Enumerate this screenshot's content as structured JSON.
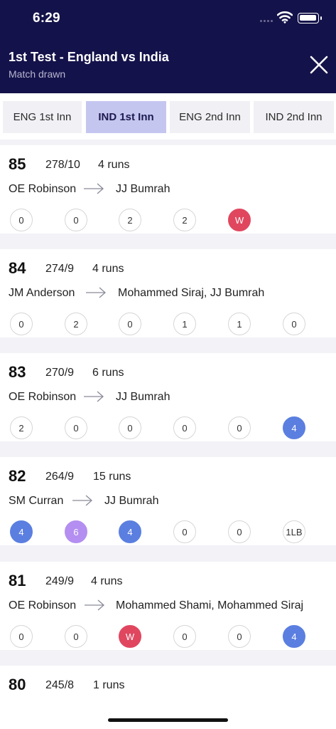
{
  "status": {
    "time": "6:29"
  },
  "header": {
    "title": "1st Test - England vs India",
    "subtitle": "Match drawn"
  },
  "tabs": [
    {
      "label": "ENG 1st Inn",
      "active": false
    },
    {
      "label": "IND 1st Inn",
      "active": true
    },
    {
      "label": "ENG 2nd Inn",
      "active": false
    },
    {
      "label": "IND 2nd Inn",
      "active": false
    }
  ],
  "overs": [
    {
      "over": "85",
      "score": "278/10",
      "runs": "4 runs",
      "bowler": "OE Robinson",
      "batters": "JJ Bumrah",
      "balls": [
        {
          "v": "0",
          "t": "dot"
        },
        {
          "v": "0",
          "t": "dot"
        },
        {
          "v": "2",
          "t": "run"
        },
        {
          "v": "2",
          "t": "run"
        },
        {
          "v": "W",
          "t": "wicket"
        }
      ]
    },
    {
      "over": "84",
      "score": "274/9",
      "runs": "4 runs",
      "bowler": "JM Anderson",
      "batters": "Mohammed Siraj, JJ Bumrah",
      "balls": [
        {
          "v": "0",
          "t": "dot"
        },
        {
          "v": "2",
          "t": "run"
        },
        {
          "v": "0",
          "t": "dot"
        },
        {
          "v": "1",
          "t": "run"
        },
        {
          "v": "1",
          "t": "run"
        },
        {
          "v": "0",
          "t": "dot"
        }
      ]
    },
    {
      "over": "83",
      "score": "270/9",
      "runs": "6 runs",
      "bowler": "OE Robinson",
      "batters": "JJ Bumrah",
      "balls": [
        {
          "v": "2",
          "t": "run"
        },
        {
          "v": "0",
          "t": "dot"
        },
        {
          "v": "0",
          "t": "dot"
        },
        {
          "v": "0",
          "t": "dot"
        },
        {
          "v": "0",
          "t": "dot"
        },
        {
          "v": "4",
          "t": "four"
        }
      ]
    },
    {
      "over": "82",
      "score": "264/9",
      "runs": "15 runs",
      "bowler": "SM Curran",
      "batters": "JJ Bumrah",
      "balls": [
        {
          "v": "4",
          "t": "four"
        },
        {
          "v": "6",
          "t": "six"
        },
        {
          "v": "4",
          "t": "four"
        },
        {
          "v": "0",
          "t": "dot"
        },
        {
          "v": "0",
          "t": "dot"
        },
        {
          "v": "1LB",
          "t": "run"
        }
      ]
    },
    {
      "over": "81",
      "score": "249/9",
      "runs": "4 runs",
      "bowler": "OE Robinson",
      "batters": "Mohammed Shami, Mohammed Siraj",
      "balls": [
        {
          "v": "0",
          "t": "dot"
        },
        {
          "v": "0",
          "t": "dot"
        },
        {
          "v": "W",
          "t": "wicket"
        },
        {
          "v": "0",
          "t": "dot"
        },
        {
          "v": "0",
          "t": "dot"
        },
        {
          "v": "4",
          "t": "four"
        }
      ]
    },
    {
      "over": "80",
      "score": "245/8",
      "runs": "1 runs",
      "bowler": "",
      "batters": "",
      "balls": []
    }
  ],
  "colors": {
    "header_bg": "#14124a",
    "active_tab": "#c5c6f0",
    "wicket": "#e0475f",
    "four": "#5b7fe0",
    "six": "#b48ef0"
  },
  "icons": {
    "close": "close-icon",
    "arrow": "arrow-right-icon",
    "wifi": "wifi-icon",
    "battery": "battery-icon"
  }
}
